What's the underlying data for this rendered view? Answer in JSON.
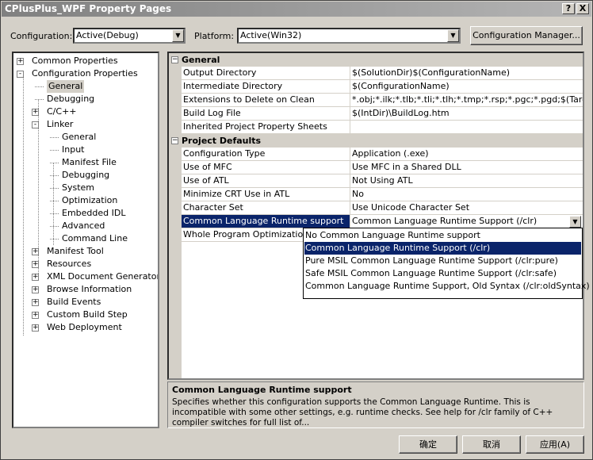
{
  "window": {
    "title": "CPlusPlus_WPF Property Pages",
    "help_btn": "?",
    "close_btn": "X"
  },
  "config": {
    "label": "Configuration:",
    "value": "Active(Debug)"
  },
  "platform": {
    "label": "Platform:",
    "value": "Active(Win32)"
  },
  "config_manager_label": "Configuration Manager...",
  "tree": [
    {
      "label": "Common Properties",
      "expander": "+"
    },
    {
      "label": "Configuration Properties",
      "expander": "-"
    },
    {
      "label": "General"
    },
    {
      "label": "Debugging"
    },
    {
      "label": "C/C++",
      "expander": "+"
    },
    {
      "label": "Linker",
      "expander": "-"
    },
    {
      "label": "General"
    },
    {
      "label": "Input"
    },
    {
      "label": "Manifest File"
    },
    {
      "label": "Debugging"
    },
    {
      "label": "System"
    },
    {
      "label": "Optimization"
    },
    {
      "label": "Embedded IDL"
    },
    {
      "label": "Advanced"
    },
    {
      "label": "Command Line"
    },
    {
      "label": "Manifest Tool",
      "expander": "+"
    },
    {
      "label": "Resources",
      "expander": "+"
    },
    {
      "label": "XML Document Generator",
      "expander": "+"
    },
    {
      "label": "Browse Information",
      "expander": "+"
    },
    {
      "label": "Build Events",
      "expander": "+"
    },
    {
      "label": "Custom Build Step",
      "expander": "+"
    },
    {
      "label": "Web Deployment",
      "expander": "+"
    }
  ],
  "grid": {
    "cat_general": "General",
    "cat_defaults": "Project Defaults",
    "general": [
      {
        "name": "Output Directory",
        "value": "$(SolutionDir)$(ConfigurationName)"
      },
      {
        "name": "Intermediate Directory",
        "value": "$(ConfigurationName)"
      },
      {
        "name": "Extensions to Delete on Clean",
        "value": "*.obj;*.ilk;*.tlb;*.tli;*.tlh;*.tmp;*.rsp;*.pgc;*.pgd;$(TargetPath)"
      },
      {
        "name": "Build Log File",
        "value": "$(IntDir)\\BuildLog.htm"
      },
      {
        "name": "Inherited Project Property Sheets",
        "value": ""
      }
    ],
    "defaults": [
      {
        "name": "Configuration Type",
        "value": "Application (.exe)"
      },
      {
        "name": "Use of MFC",
        "value": "Use MFC in a Shared DLL"
      },
      {
        "name": "Use of ATL",
        "value": "Not Using ATL"
      },
      {
        "name": "Minimize CRT Use in ATL",
        "value": "No"
      },
      {
        "name": "Character Set",
        "value": "Use Unicode Character Set"
      },
      {
        "name": "Common Language Runtime support",
        "value": "Common Language Runtime Support (/clr)"
      },
      {
        "name": "Whole Program Optimization",
        "value": ""
      }
    ]
  },
  "dropdown": [
    "No Common Language Runtime support",
    "Common Language Runtime Support (/clr)",
    "Pure MSIL Common Language Runtime Support (/clr:pure)",
    "Safe MSIL Common Language Runtime Support (/clr:safe)",
    "Common Language Runtime Support, Old Syntax (/clr:oldSyntax)"
  ],
  "description": {
    "title": "Common Language Runtime support",
    "text": "Specifies whether this configuration supports the Common Language Runtime.  This is incompatible with some other settings, e.g. runtime checks. See help for /clr family of C++ compiler switches for full list of..."
  },
  "buttons": {
    "ok": "确定",
    "cancel": "取消",
    "apply": "应用(A)"
  }
}
